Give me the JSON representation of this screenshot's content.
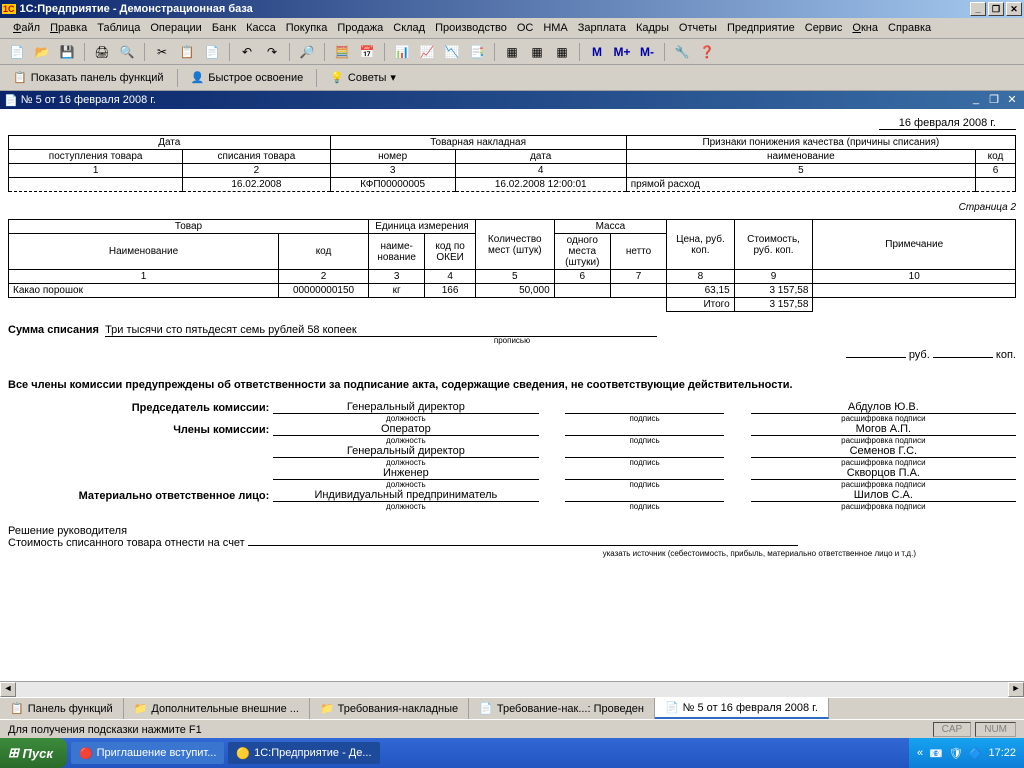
{
  "app_title": "1С:Предприятие - Демонстрационная база",
  "menu": [
    "Файл",
    "Правка",
    "Таблица",
    "Операции",
    "Банк",
    "Касса",
    "Покупка",
    "Продажа",
    "Склад",
    "Производство",
    "ОС",
    "НМА",
    "Зарплата",
    "Кадры",
    "Отчеты",
    "Предприятие",
    "Сервис",
    "Окна",
    "Справка"
  ],
  "toolbar2": {
    "show_panel": "Показать панель функций",
    "quick_learn": "Быстрое освоение",
    "tips": "Советы"
  },
  "doc_title": "№ 5 от 16 февраля 2008 г.",
  "doc": {
    "top_date": "16 февраля 2008 г.",
    "hdr": {
      "date": "Дата",
      "receipt": "поступления товара",
      "writeoff": "списания товара",
      "invoice": "Товарная накладная",
      "number": "номер",
      "inv_date": "дата",
      "quality": "Признаки понижения качества (причины списания)",
      "name": "наименование",
      "code": "код"
    },
    "nums": {
      "c1": "1",
      "c2": "2",
      "c3": "3",
      "c4": "4",
      "c5": "5",
      "c6": "6"
    },
    "row": {
      "receipt": "",
      "writeoff": "16.02.2008",
      "number": "КФП00000005",
      "inv_date": "16.02.2008 12:00:01",
      "quality": "прямой расход",
      "code": ""
    },
    "page_label": "Страница 2",
    "tbl2_hdr": {
      "product": "Товар",
      "unit": "Единица измерения",
      "qty": "Количество мест (штук)",
      "mass": "Масса",
      "price": "Цена, руб. коп.",
      "cost": "Стоимость, руб. коп.",
      "note": "Примечание",
      "name": "Наименование",
      "code": "код",
      "uname": "наиме-нование",
      "okei": "код по ОКЕИ",
      "one": "одного места (штуки)",
      "net": "нетто"
    },
    "nums2": {
      "c1": "1",
      "c2": "2",
      "c3": "3",
      "c4": "4",
      "c5": "5",
      "c6": "6",
      "c7": "7",
      "c8": "8",
      "c9": "9",
      "c10": "10"
    },
    "item": {
      "name": "Какао порошок",
      "code": "00000000150",
      "uname": "кг",
      "okei": "166",
      "qty": "50,000",
      "mass_one": "",
      "mass_net": "",
      "price": "63,15",
      "cost": "3 157,58",
      "note": ""
    },
    "total_label": "Итого",
    "total": "3 157,58",
    "sum_label": "Сумма списания",
    "sum_text": "Три тысячи сто пятьдесят семь рублей 58 копеек",
    "sum_under": "прописью",
    "rub": "руб.",
    "kop": "коп.",
    "warn": "Все члены комиссии предупреждены об ответственности за подписание акта, содержащие сведения, не соответствующие действительности.",
    "sig": {
      "chairman_lbl": "Председатель комиссии:",
      "members_lbl": "Члены комиссии:",
      "responsible_lbl": "Материально ответственное лицо:",
      "position": "должность",
      "signature": "подпись",
      "decrypt": "расшифровка подписи",
      "rows": [
        {
          "pos": "Генеральный директор",
          "name": "Абдулов Ю.В."
        },
        {
          "pos": "Оператор",
          "name": "Могов А.П."
        },
        {
          "pos": "Генеральный директор",
          "name": "Семенов Г.С."
        },
        {
          "pos": "Инженер",
          "name": "Скворцов П.А."
        },
        {
          "pos": "Индивидуальный предприниматель",
          "name": "Шилов С.А."
        }
      ]
    },
    "decision1": "Решение руководителя",
    "decision2": "Стоимость списанного товара отнести на счет",
    "decision_under": "указать источник (себестоимость, прибыль, материально ответственное лицо и т.д.)"
  },
  "wintabs": [
    "Панель функций",
    "Дополнительные внешние ...",
    "Требования-накладные",
    "Требование-нак...: Проведен",
    "№ 5 от 16 февраля 2008 г."
  ],
  "status_hint": "Для получения подсказки нажмите F1",
  "status_cap": "CAP",
  "status_num": "NUM",
  "taskbar": {
    "start": "Пуск",
    "tasks": [
      "Приглашение вступит...",
      "1С:Предприятие - Де..."
    ],
    "time": "17:22"
  }
}
